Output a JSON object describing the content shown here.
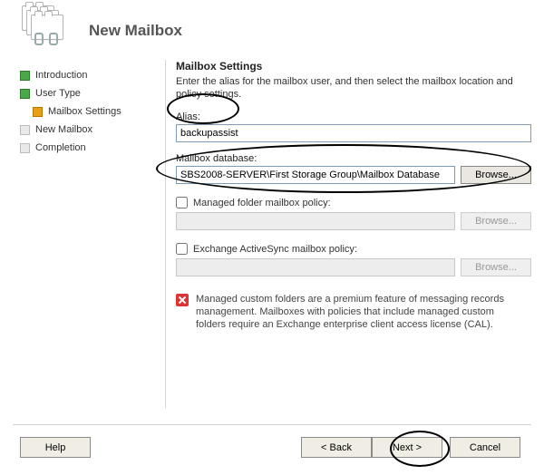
{
  "title": "New Mailbox",
  "sidebar": {
    "items": [
      {
        "label": "Introduction"
      },
      {
        "label": "User Type"
      },
      {
        "label": "Mailbox Settings"
      },
      {
        "label": "New Mailbox"
      },
      {
        "label": "Completion"
      }
    ]
  },
  "main": {
    "heading": "Mailbox Settings",
    "intro": "Enter the alias for the mailbox user, and then select the mailbox location and policy settings.",
    "alias_label": "Alias:",
    "alias_value": "backupassist",
    "db_label": "Mailbox database:",
    "db_value": "SBS2008-SERVER\\First Storage Group\\Mailbox Database",
    "browse_label": "Browse...",
    "folder_policy_label": "Managed folder mailbox policy:",
    "activesync_label": "Exchange ActiveSync mailbox policy:",
    "note": "Managed custom folders are a premium feature of messaging records management. Mailboxes with policies that include managed custom folders require an Exchange enterprise client access license (CAL)."
  },
  "buttons": {
    "help": "Help",
    "back": "< Back",
    "next": "Next >",
    "cancel": "Cancel"
  }
}
